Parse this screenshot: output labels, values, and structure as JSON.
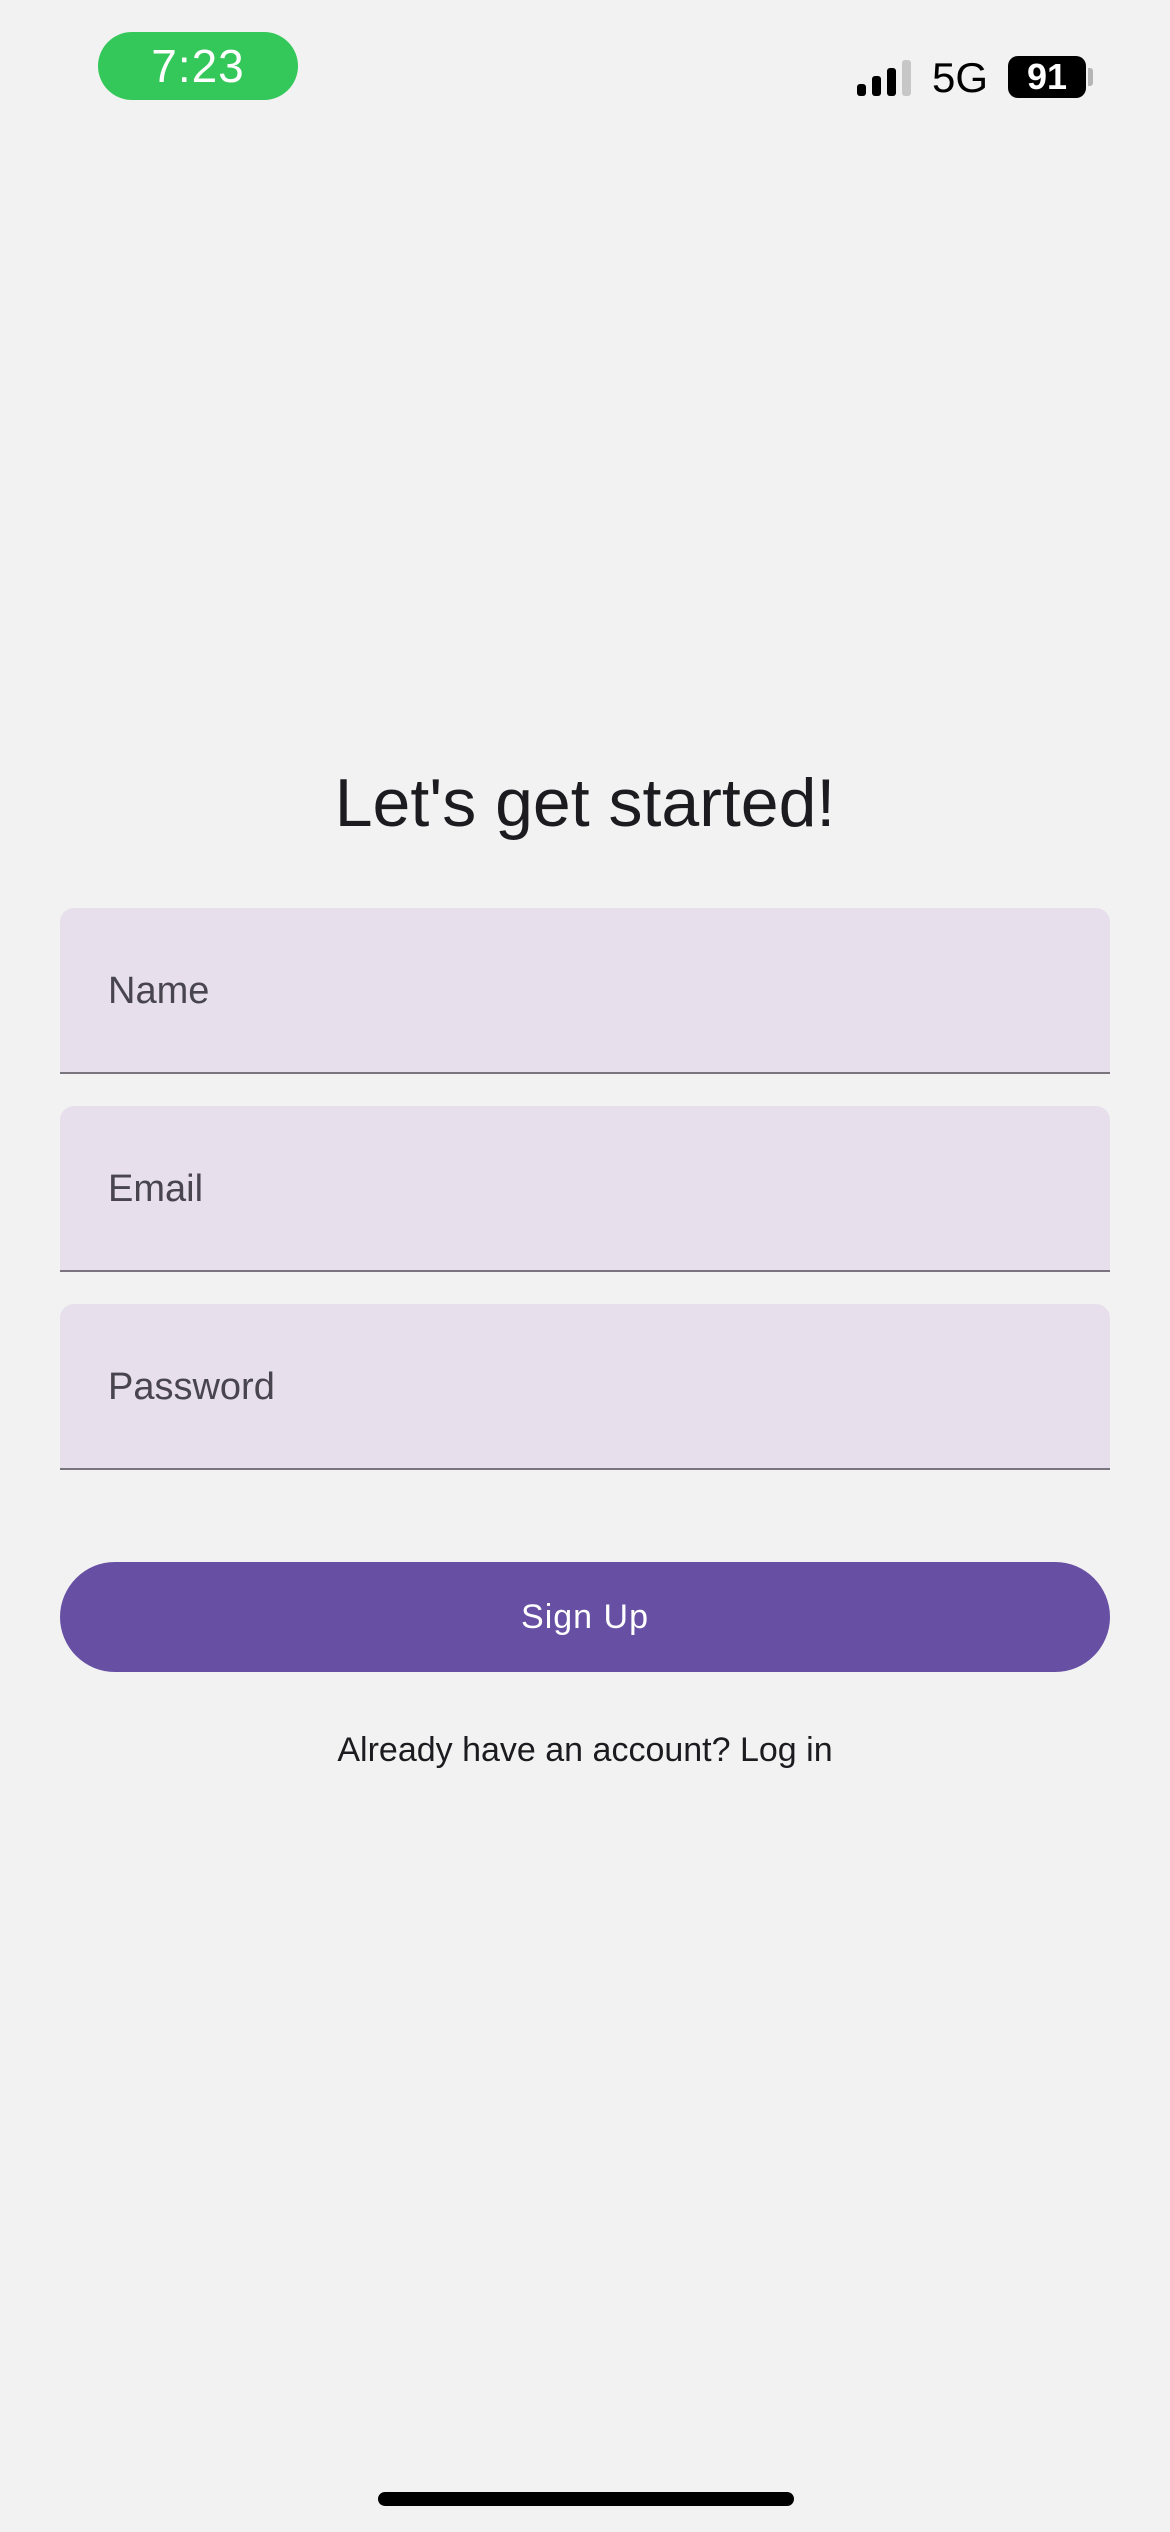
{
  "status_bar": {
    "time": "7:23",
    "network": "5G",
    "battery": "91",
    "time_pill_color": "#34c759",
    "signal_icon": "signal-bars-icon"
  },
  "signup": {
    "title": "Let's get started!",
    "name_placeholder": "Name",
    "email_placeholder": "Email",
    "password_placeholder": "Password",
    "button_label": "Sign Up",
    "login_prompt": "Already have an account? Log in",
    "accent_color": "#6750a4",
    "field_background": "#e7dfec"
  }
}
